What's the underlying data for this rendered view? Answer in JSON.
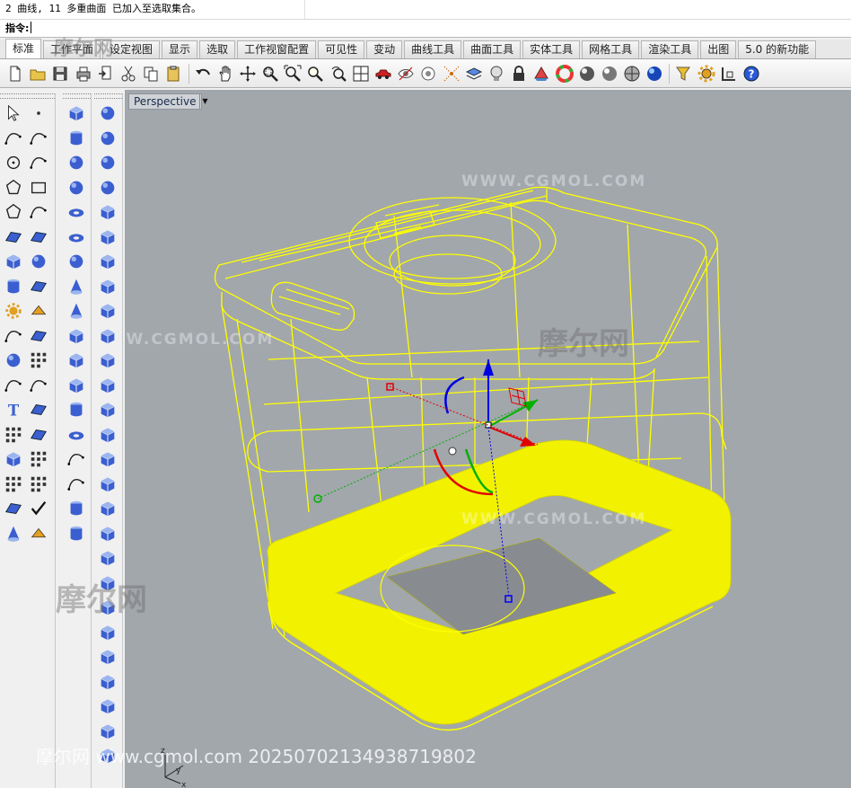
{
  "command": {
    "history_line": "2 曲线, 11 多重曲面 已加入至选取集合。",
    "prompt_label": "指令:"
  },
  "tabs": [
    "标准",
    "工作平面",
    "设定视图",
    "显示",
    "选取",
    "工作视窗配置",
    "可见性",
    "变动",
    "曲线工具",
    "曲面工具",
    "实体工具",
    "网格工具",
    "渲染工具",
    "出图",
    "5.0 的新功能"
  ],
  "active_tab": "标准",
  "toolbar_icons": [
    "new-icon",
    "open-icon",
    "save-icon",
    "print-icon",
    "import-icon",
    "cut-icon",
    "copy-icon",
    "paste-icon",
    "undo-icon",
    "pan-icon",
    "rotate-view-icon",
    "zoom-window-icon",
    "zoom-extents-icon",
    "zoom-selected-icon",
    "zoom-dynamic-icon",
    "four-viewports-icon",
    "car-icon",
    "hide-icon",
    "show-icon",
    "point-icon",
    "layer-icon",
    "light-bulb-icon",
    "lock-icon",
    "material-icon",
    "color-wheel-icon",
    "shaded-sphere-icon",
    "rendered-sphere-icon",
    "ghosted-sphere-icon",
    "render-icon",
    "filter-icon",
    "options-gear-icon",
    "snap-icon",
    "help-icon"
  ],
  "viewport": {
    "title": "Perspective",
    "axis_labels": {
      "x": "x",
      "y": "y",
      "z": "z"
    }
  },
  "watermarks": {
    "url": "WWW.CGMOL.COM",
    "logo": "摩尔网",
    "footer": "摩尔网 www.cgmol.com 20250702134938719802"
  },
  "colors": {
    "viewport_bg": "#a2a7ac",
    "wireframe": "#ffff00",
    "gumball_x": "#e00000",
    "gumball_y": "#00b000",
    "gumball_z": "#0000e0"
  }
}
